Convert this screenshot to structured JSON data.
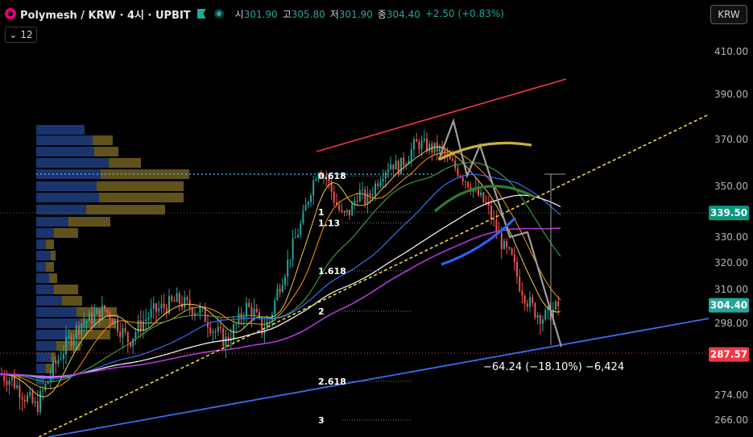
{
  "header": {
    "symbol": "Polymesh / KRW · 4시 · UPBIT",
    "open_label": "시",
    "open": "301.90",
    "high_label": "고",
    "high": "305.80",
    "low_label": "저",
    "low": "301.90",
    "close_label": "종",
    "close": "304.40",
    "change": "+2.50 (+0.83%)"
  },
  "indicator_toggle": {
    "count": "12"
  },
  "currency_button": "KRW",
  "colors": {
    "up": "#26a69a",
    "down": "#ef5350",
    "price_badge": "#26a69a",
    "low_badge": "#f23645",
    "green_badge": "#089981"
  },
  "chart_data": {
    "type": "candlestick",
    "y_axis": {
      "min": 263.5,
      "max": 420,
      "ticks": [
        {
          "value": 410,
          "label": "410.00"
        },
        {
          "value": 390,
          "label": "390.00"
        },
        {
          "value": 370,
          "label": "370.00"
        },
        {
          "value": 350,
          "label": "350.00"
        },
        {
          "value": 330,
          "label": "330.00"
        },
        {
          "value": 320,
          "label": "320.00"
        },
        {
          "value": 310,
          "label": "310.00"
        },
        {
          "value": 298,
          "label": "298.00"
        },
        {
          "value": 274,
          "label": "274.00"
        },
        {
          "value": 266,
          "label": "266.00"
        }
      ]
    },
    "price_badges": [
      {
        "value": 339.5,
        "label": "339.50",
        "color": "#089981"
      },
      {
        "value": 304.4,
        "label": "304.40",
        "color": "#26a69a"
      },
      {
        "value": 287.57,
        "label": "287.57",
        "color": "#f23645"
      }
    ],
    "fib_levels": [
      {
        "label": "0.618",
        "value": 354.4
      },
      {
        "label": "1",
        "value": 339.9
      },
      {
        "label": "1.13",
        "value": 335.5
      },
      {
        "label": "1.618",
        "value": 317.0
      },
      {
        "label": "2",
        "value": 302.3
      },
      {
        "label": "2.618",
        "value": 278.6
      },
      {
        "label": "3",
        "value": 266.0
      }
    ],
    "measure_annotation": "−64.24 (−18.10%) −6,424",
    "price_path": [
      [
        0,
        281
      ],
      [
        15,
        279
      ],
      [
        30,
        274
      ],
      [
        45,
        270
      ],
      [
        55,
        276
      ],
      [
        70,
        285
      ],
      [
        85,
        292
      ],
      [
        100,
        298
      ],
      [
        115,
        300
      ],
      [
        130,
        303
      ],
      [
        145,
        298
      ],
      [
        160,
        292
      ],
      [
        175,
        298
      ],
      [
        190,
        302
      ],
      [
        205,
        304
      ],
      [
        220,
        306
      ],
      [
        235,
        304
      ],
      [
        250,
        302
      ],
      [
        265,
        296
      ],
      [
        280,
        292
      ],
      [
        295,
        298
      ],
      [
        305,
        304
      ],
      [
        315,
        302
      ],
      [
        325,
        296
      ],
      [
        335,
        299
      ],
      [
        345,
        310
      ],
      [
        355,
        318
      ],
      [
        365,
        328
      ],
      [
        375,
        336
      ],
      [
        385,
        348
      ],
      [
        395,
        358
      ],
      [
        405,
        354
      ],
      [
        415,
        345
      ],
      [
        425,
        338
      ],
      [
        435,
        340
      ],
      [
        445,
        348
      ],
      [
        455,
        344
      ],
      [
        465,
        350
      ],
      [
        475,
        356
      ],
      [
        485,
        360
      ],
      [
        495,
        358
      ],
      [
        505,
        362
      ],
      [
        515,
        368
      ],
      [
        525,
        368
      ],
      [
        535,
        366
      ],
      [
        545,
        366
      ],
      [
        555,
        362
      ],
      [
        565,
        358
      ],
      [
        575,
        354
      ],
      [
        585,
        350
      ],
      [
        595,
        346
      ],
      [
        605,
        342
      ],
      [
        615,
        334
      ],
      [
        625,
        326
      ],
      [
        635,
        322
      ],
      [
        645,
        312
      ],
      [
        655,
        306
      ],
      [
        665,
        302
      ],
      [
        675,
        300
      ],
      [
        685,
        302
      ],
      [
        695,
        304.4
      ]
    ]
  }
}
